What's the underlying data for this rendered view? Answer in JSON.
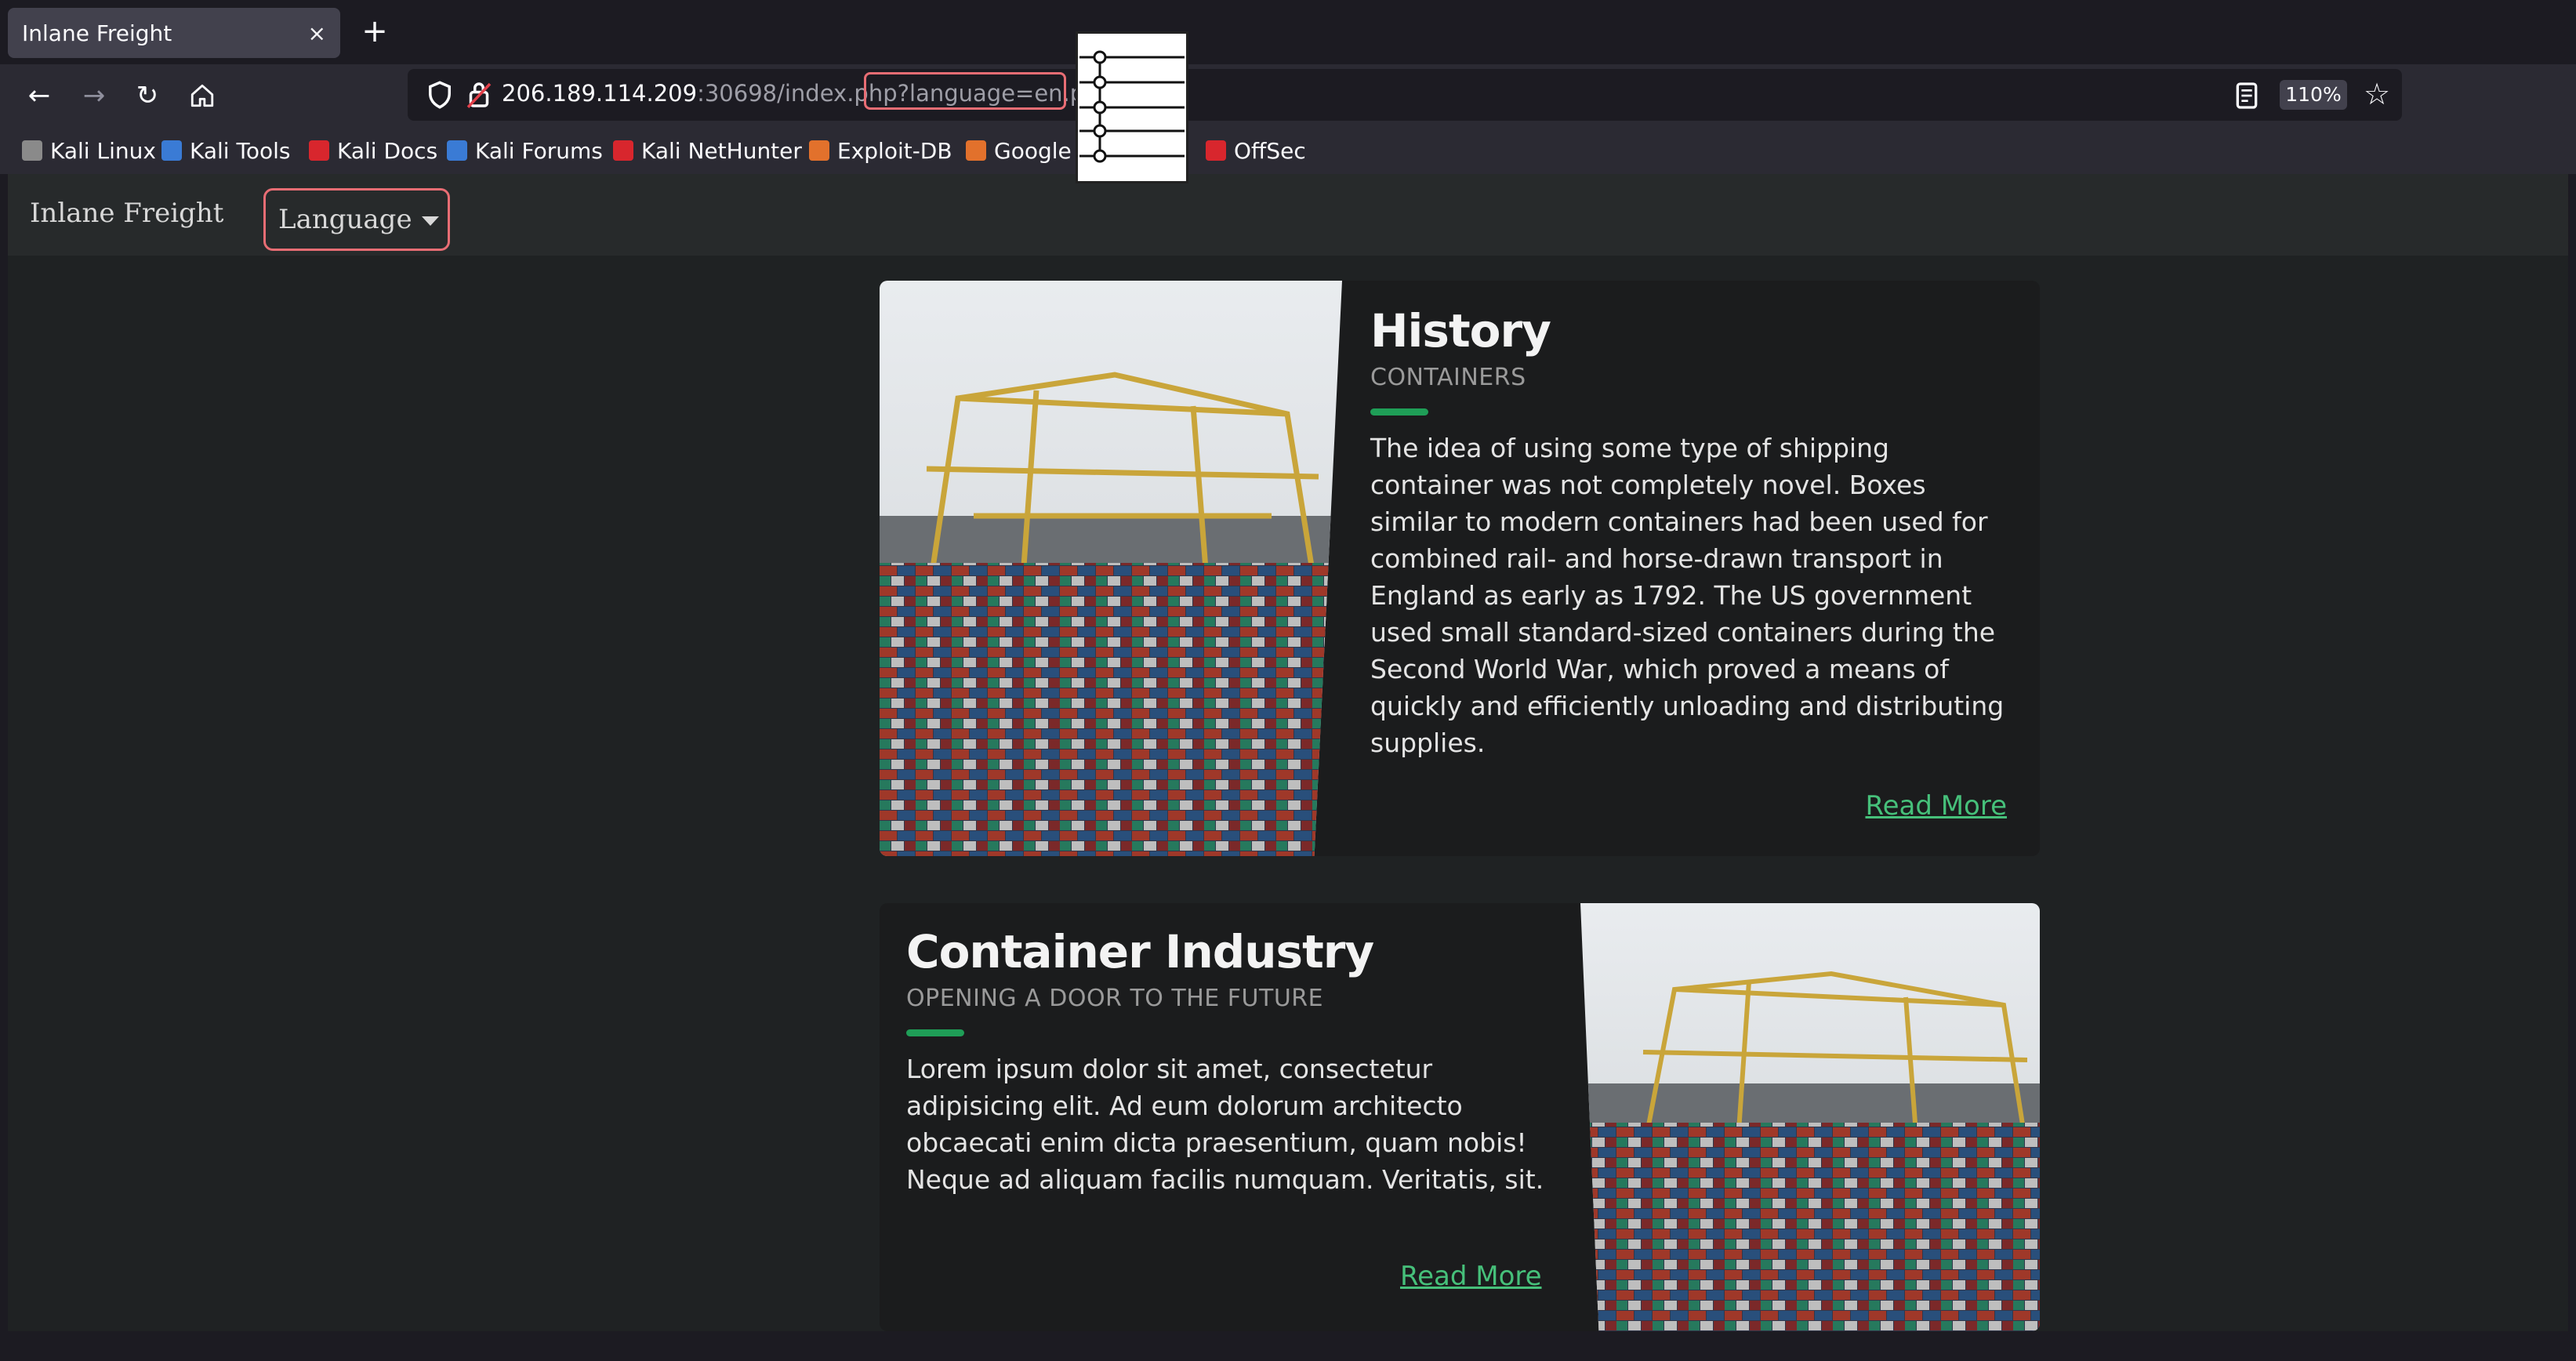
{
  "browser": {
    "tab": {
      "title": "Inlane Freight",
      "close_glyph": "×"
    },
    "new_tab_glyph": "+",
    "nav": {
      "back_glyph": "←",
      "forward_glyph": "→",
      "reload_glyph": "↻"
    },
    "url": {
      "host": "206.189.114.209",
      "path": ":30698/index.php?language=en.php"
    },
    "zoom": "110%",
    "bookmark_star": "☆",
    "bookmarks": [
      {
        "label": "Kali Linux",
        "icon": "kali-dragon-icon",
        "color": "#8a8a8a"
      },
      {
        "label": "Kali Tools",
        "icon": "kali-tools-icon",
        "color": "#3a7bd5"
      },
      {
        "label": "Kali Docs",
        "icon": "kali-docs-icon",
        "color": "#d8262d"
      },
      {
        "label": "Kali Forums",
        "icon": "kali-forums-icon",
        "color": "#3a7bd5"
      },
      {
        "label": "Kali NetHunter",
        "icon": "kali-nethunter-icon",
        "color": "#d8262d"
      },
      {
        "label": "Exploit-DB",
        "icon": "exploit-db-icon",
        "color": "#e2712c"
      },
      {
        "label": "Google",
        "icon": "google-hacking-db-icon",
        "color": "#e2712c"
      },
      {
        "label": "OffSec",
        "icon": "offsec-icon",
        "color": "#d8262d"
      }
    ]
  },
  "site": {
    "brand": "Inlane Freight",
    "language_button": "Language",
    "colors": {
      "accent": "#1f9e57",
      "link": "#46c07a",
      "highlight": "#e86d74"
    }
  },
  "cards": [
    {
      "title": "History",
      "subtitle": "CONTAINERS",
      "body": "The idea of using some type of shipping container was not completely novel. Boxes similar to modern containers had been used for combined rail- and horse-drawn transport in England as early as 1792. The US government used small standard-sized containers during the Second World War, which proved a means of quickly and efficiently unloading and distributing supplies.",
      "link": "Read More"
    },
    {
      "title": "Container Industry",
      "subtitle": "OPENING A DOOR TO THE FUTURE",
      "body": "Lorem ipsum dolor sit amet, consectetur adipisicing elit. Ad eum dolorum architecto obcaecati enim dicta praesentium, quam nobis! Neque ad aliquam facilis numquam. Veritatis, sit.",
      "link": "Read More"
    }
  ]
}
